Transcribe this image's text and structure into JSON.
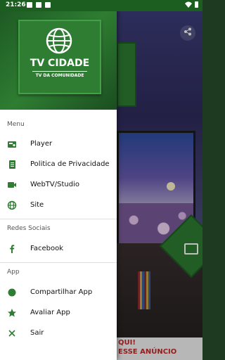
{
  "status_bar": {
    "time": "21:26"
  },
  "app": {
    "name": "TV CIDADE",
    "slogan": "TV DA COMUNIDADE",
    "background_ad": {
      "line1": "QUI!",
      "line2": "ESSE ANÚNCIO"
    }
  },
  "drawer": {
    "sections": {
      "menu": "Menu",
      "social": "Redes Sociais",
      "app": "App"
    },
    "menu_items": [
      {
        "label": "Player",
        "icon": "radio-icon"
      },
      {
        "label": "Politica de Privacidade",
        "icon": "document-icon"
      },
      {
        "label": "WebTV/Studio",
        "icon": "video-camera-icon"
      },
      {
        "label": "Site",
        "icon": "globe-icon"
      }
    ],
    "social_items": [
      {
        "label": "Facebook",
        "icon": "facebook-icon"
      }
    ],
    "app_items": [
      {
        "label": "Compartilhar App",
        "icon": "circle-icon"
      },
      {
        "label": "Avaliar App",
        "icon": "star-icon"
      },
      {
        "label": "Sair",
        "icon": "close-icon"
      }
    ]
  },
  "colors": {
    "primary": "#2e7d32",
    "dark": "#1b5e20"
  }
}
